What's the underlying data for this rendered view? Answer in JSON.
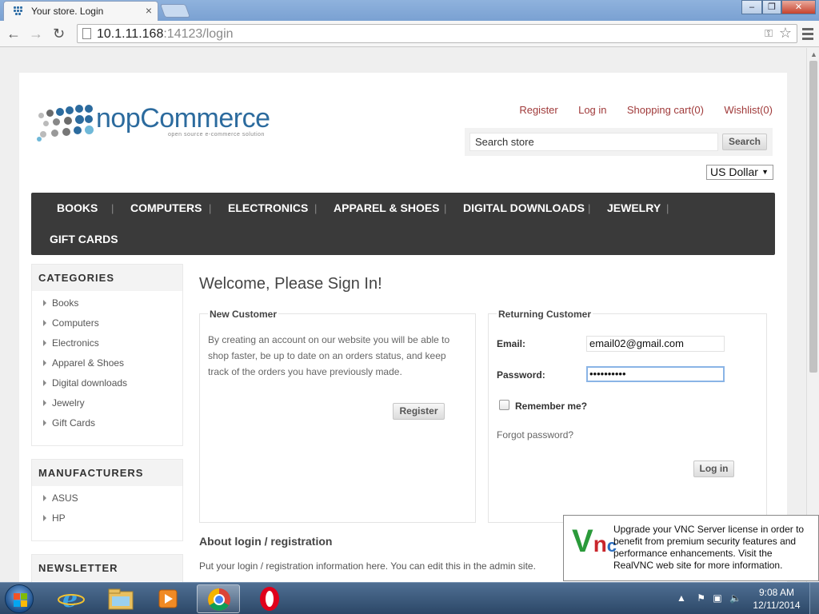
{
  "browser": {
    "tab_title": "Your store. Login",
    "tab_close": "×",
    "url_host": "10.1.11.168",
    "url_rest": ":14123/login",
    "minimize": "–",
    "restore": "❐",
    "close": "✕"
  },
  "header": {
    "logo_text": "nopCommerce",
    "logo_tagline": "open source e-commerce solution",
    "links": [
      "Register",
      "Log in",
      "Shopping cart(0)",
      "Wishlist(0)"
    ],
    "search_placeholder": "Search store",
    "search_button": "Search",
    "currency": "US Dollar",
    "currency_caret": "▼"
  },
  "menu": {
    "items": [
      "BOOKS",
      "COMPUTERS",
      "ELECTRONICS",
      "APPAREL & SHOES",
      "DIGITAL DOWNLOADS",
      "JEWELRY",
      "GIFT CARDS"
    ],
    "separator": "|"
  },
  "sidebar": {
    "categories_title": "CATEGORIES",
    "categories": [
      "Books",
      "Computers",
      "Electronics",
      "Apparel & Shoes",
      "Digital downloads",
      "Jewelry",
      "Gift Cards"
    ],
    "manufacturers_title": "MANUFACTURERS",
    "manufacturers": [
      "ASUS",
      "HP"
    ],
    "newsletter_title": "NEWSLETTER"
  },
  "main": {
    "page_title": "Welcome, Please Sign In!",
    "new_customer": {
      "title": "New Customer",
      "text": "By creating an account on our website you will be able to shop faster, be up to date on an orders status, and keep track of the orders you have previously made.",
      "register_button": "Register"
    },
    "returning_customer": {
      "title": "Returning Customer",
      "email_label": "Email:",
      "email_value": "email02@gmail.com",
      "password_label": "Password:",
      "password_value": "••••••••••",
      "remember_label": "Remember me?",
      "forgot_link": "Forgot password?",
      "login_button": "Log in"
    },
    "about_title": "About login / registration",
    "about_text": "Put your login / registration information here. You can edit this in the admin site."
  },
  "vnc_popup": {
    "logo": "Vnc",
    "text": "Upgrade your VNC Server license in order to benefit from premium security features and performance enhancements. Visit the RealVNC web site for more information."
  },
  "taskbar": {
    "time": "9:08 AM",
    "date": "12/11/2014"
  },
  "colors": {
    "accent_link": "#a03a3a",
    "menu_bg": "#3a3a3a",
    "logo_blue": "#2c6b9e"
  }
}
